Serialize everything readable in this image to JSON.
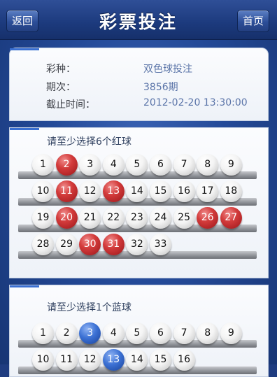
{
  "header": {
    "title": "彩票投注",
    "back_label": "返回",
    "home_label": "首页"
  },
  "info": {
    "rows": [
      {
        "label": "彩种：",
        "value": "双色球投注"
      },
      {
        "label": "期次：",
        "value": "3856期"
      },
      {
        "label": "截止时间：",
        "value": "2012-02-20 13:30:00"
      }
    ]
  },
  "red_section": {
    "title": "请至少选择6个红球",
    "numbers": [
      "1",
      "2",
      "3",
      "4",
      "5",
      "6",
      "7",
      "8",
      "9",
      "10",
      "11",
      "12",
      "13",
      "14",
      "15",
      "16",
      "17",
      "18",
      "19",
      "20",
      "21",
      "22",
      "23",
      "24",
      "25",
      "26",
      "27",
      "28",
      "29",
      "30",
      "31",
      "32",
      "33"
    ],
    "selected": [
      "2",
      "11",
      "13",
      "20",
      "26",
      "27",
      "30",
      "31"
    ]
  },
  "blue_section": {
    "title": "请至少选择1个蓝球",
    "numbers": [
      "1",
      "2",
      "3",
      "4",
      "5",
      "6",
      "7",
      "8",
      "9",
      "10",
      "11",
      "12",
      "13",
      "14",
      "15",
      "16"
    ],
    "selected": [
      "3",
      "13"
    ]
  },
  "colors": {
    "red_ball": "#c62d2f",
    "blue_ball": "#2f5fc0",
    "header": "#1c3a7d"
  }
}
